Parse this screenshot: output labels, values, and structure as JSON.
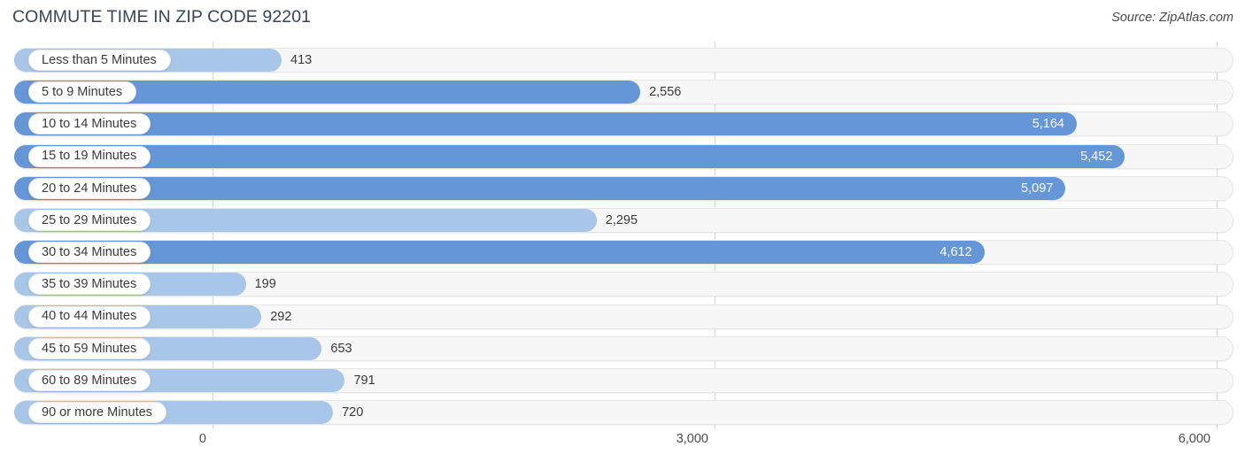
{
  "header": {
    "title": "COMMUTE TIME IN ZIP CODE 92201",
    "source": "Source: ZipAtlas.com"
  },
  "colors": {
    "bar_light": "#a8c6e8",
    "bar_dark": "#6596d8",
    "track": "#f7f7f7",
    "gridline": "#d4d4d4",
    "title": "#3c4451",
    "text": "#3a3a3a",
    "value_inside": "#ffffff"
  },
  "chart_data": {
    "type": "bar",
    "orientation": "horizontal",
    "title": "COMMUTE TIME IN ZIP CODE 92201",
    "xlabel": "",
    "ylabel": "",
    "xlim": [
      0,
      6000
    ],
    "grid": true,
    "legend": null,
    "source": "Source: ZipAtlas.com",
    "xticks": [
      0,
      3000,
      6000
    ],
    "xticklabels": [
      "0",
      "3,000",
      "6,000"
    ],
    "categories": [
      "Less than 5 Minutes",
      "5 to 9 Minutes",
      "10 to 14 Minutes",
      "15 to 19 Minutes",
      "20 to 24 Minutes",
      "25 to 29 Minutes",
      "30 to 34 Minutes",
      "35 to 39 Minutes",
      "40 to 44 Minutes",
      "45 to 59 Minutes",
      "60 to 89 Minutes",
      "90 or more Minutes"
    ],
    "values": [
      413,
      2556,
      5164,
      5452,
      5097,
      2295,
      4612,
      199,
      292,
      653,
      791,
      720
    ],
    "value_labels": [
      "413",
      "2,556",
      "5,164",
      "5,452",
      "5,097",
      "2,295",
      "4,612",
      "199",
      "292",
      "653",
      "791",
      "720"
    ],
    "rows": [
      {
        "label": "Less than 5 Minutes",
        "value": 413,
        "value_label": "413",
        "shade": "light",
        "label_inside": false
      },
      {
        "label": "5 to 9 Minutes",
        "value": 2556,
        "value_label": "2,556",
        "shade": "dark",
        "label_inside": false
      },
      {
        "label": "10 to 14 Minutes",
        "value": 5164,
        "value_label": "5,164",
        "shade": "dark",
        "label_inside": true
      },
      {
        "label": "15 to 19 Minutes",
        "value": 5452,
        "value_label": "5,452",
        "shade": "dark",
        "label_inside": true
      },
      {
        "label": "20 to 24 Minutes",
        "value": 5097,
        "value_label": "5,097",
        "shade": "dark",
        "label_inside": true
      },
      {
        "label": "25 to 29 Minutes",
        "value": 2295,
        "value_label": "2,295",
        "shade": "light",
        "label_inside": false
      },
      {
        "label": "30 to 34 Minutes",
        "value": 4612,
        "value_label": "4,612",
        "shade": "dark",
        "label_inside": true
      },
      {
        "label": "35 to 39 Minutes",
        "value": 199,
        "value_label": "199",
        "shade": "light",
        "label_inside": false
      },
      {
        "label": "40 to 44 Minutes",
        "value": 292,
        "value_label": "292",
        "shade": "light",
        "label_inside": false
      },
      {
        "label": "45 to 59 Minutes",
        "value": 653,
        "value_label": "653",
        "shade": "light",
        "label_inside": false
      },
      {
        "label": "60 to 89 Minutes",
        "value": 791,
        "value_label": "791",
        "shade": "light",
        "label_inside": false
      },
      {
        "label": "90 or more Minutes",
        "value": 720,
        "value_label": "720",
        "shade": "light",
        "label_inside": false
      }
    ]
  }
}
